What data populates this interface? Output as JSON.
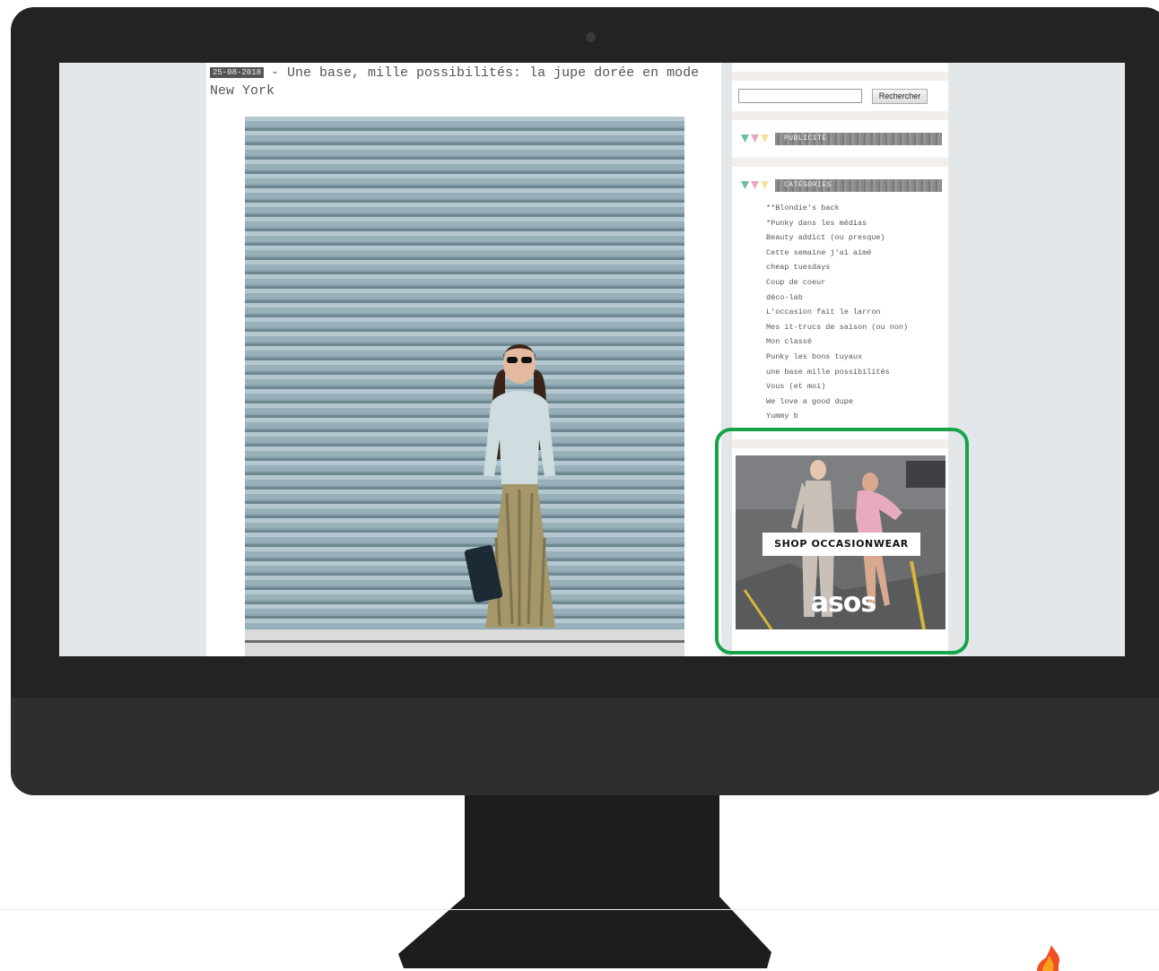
{
  "post": {
    "date": "25-08-2018",
    "title": "- Une base, mille possibilités: la jupe dorée en mode New York"
  },
  "sidebar": {
    "search_button_label": "Rechercher",
    "ad_widget_title": "PUBLICITÉ",
    "categories_widget_title": "CATÉGORIES",
    "categories": [
      "**Blondie's back",
      "*Punky dans les médias",
      "Beauty addict (ou presque)",
      "Cette semaine j'ai aimé",
      "cheap tuesdays",
      "Coup de coeur",
      "déco-lab",
      "L'occasion fait le larron",
      "Mes it-trucs de saison (ou non)",
      "Mon classé",
      "Punky les bons tuyaux",
      "une base mille possibilités",
      "Vous (et moi)",
      "We love a good dupe",
      "Yummy b"
    ]
  },
  "ad": {
    "cta_label": "SHOP OCCASIONWEAR",
    "brand": "asos"
  },
  "colors": {
    "highlight": "#16a34a",
    "bezel": "#232323",
    "screen_bg": "#e4e7ea"
  },
  "icons": [
    "camera-icon",
    "triangle-bunting-icon",
    "flame-logo-icon"
  ]
}
